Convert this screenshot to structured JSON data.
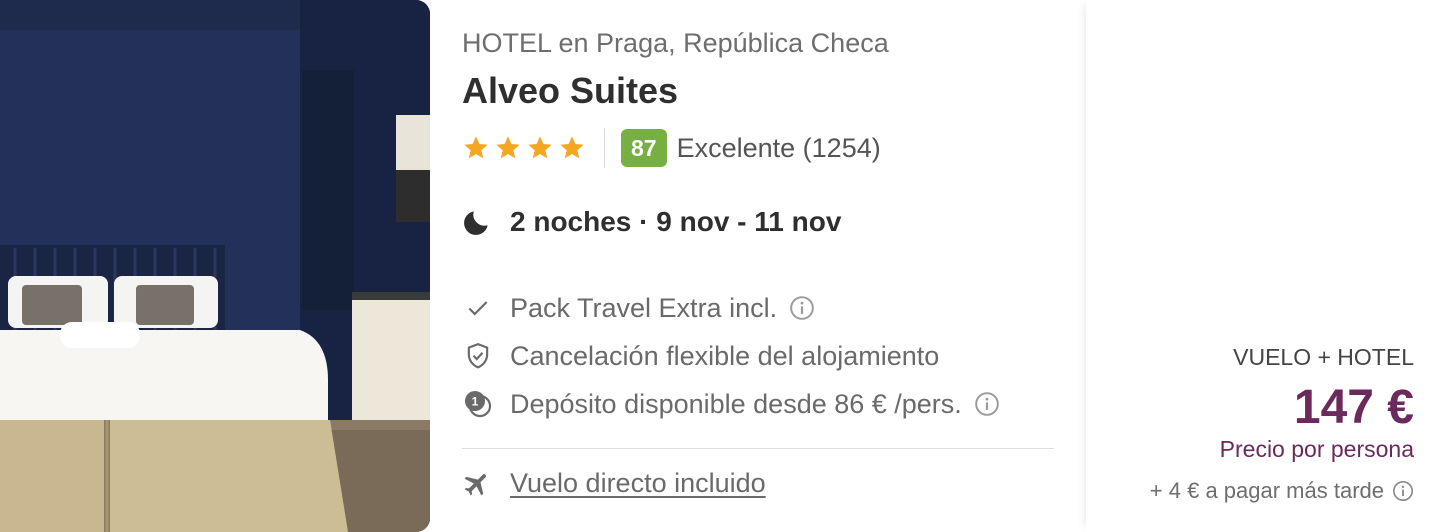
{
  "hotel": {
    "location": "HOTEL en Praga, República Checa",
    "name": "Alveo Suites",
    "stars": 4,
    "score": "87",
    "rating_text": "Excelente (1254)"
  },
  "stay": {
    "text": "2 noches · 9 nov - 11 nov"
  },
  "features": [
    {
      "icon": "check-icon",
      "label": "Pack Travel Extra incl.",
      "has_info": true
    },
    {
      "icon": "shield-icon",
      "label": "Cancelación flexible del alojamiento",
      "has_info": false
    },
    {
      "icon": "deposit-icon",
      "label": "Depósito disponible desde 86 € /pers.",
      "has_info": true
    }
  ],
  "flight": {
    "label": "Vuelo directo incluido",
    "icon": "plane-icon"
  },
  "price": {
    "type": "VUELO + HOTEL",
    "amount": "147 €",
    "per_person": "Precio por persona",
    "pay_later": "+ 4 € a pagar más tarde"
  },
  "colors": {
    "score_badge": "#76b043",
    "star": "#f5a623",
    "price": "#6a2a5c"
  }
}
